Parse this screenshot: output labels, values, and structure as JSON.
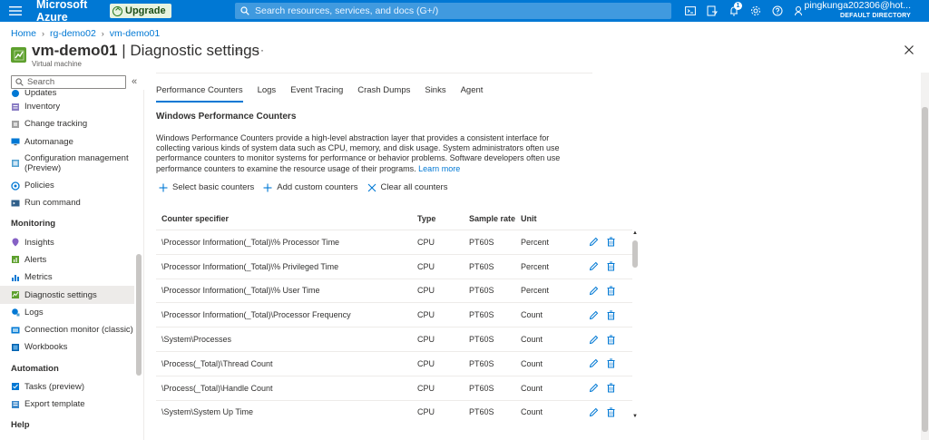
{
  "topbar": {
    "brand": "Microsoft Azure",
    "upgrade_label": "Upgrade",
    "search_placeholder": "Search resources, services, and docs (G+/)",
    "notification_count": "1",
    "user": "pingkunga202306@hot...",
    "directory": "DEFAULT DIRECTORY",
    "icons": [
      "cloud-shell-icon",
      "directory-filter-icon",
      "notifications-icon",
      "settings-icon",
      "help-icon",
      "feedback-icon"
    ]
  },
  "breadcrumb": [
    "Home",
    "rg-demo02",
    "vm-demo01"
  ],
  "header": {
    "resource_name": "vm-demo01",
    "separator": " | ",
    "page_name": "Diagnostic settings",
    "subtitle": "Virtual machine"
  },
  "sidebar": {
    "search_placeholder": "Search",
    "collapse_glyph": "«",
    "items": [
      {
        "label": "Updates",
        "icon": "updates-icon"
      },
      {
        "label": "Inventory",
        "icon": "inventory-icon"
      },
      {
        "label": "Change tracking",
        "icon": "change-tracking-icon"
      },
      {
        "label": "Automanage",
        "icon": "automanage-icon"
      },
      {
        "label": "Configuration management (Preview)",
        "icon": "configuration-icon"
      },
      {
        "label": "Policies",
        "icon": "policies-icon"
      },
      {
        "label": "Run command",
        "icon": "run-command-icon"
      }
    ],
    "group_monitoring": "Monitoring",
    "monitoring_items": [
      {
        "label": "Insights",
        "icon": "insights-icon"
      },
      {
        "label": "Alerts",
        "icon": "alerts-icon"
      },
      {
        "label": "Metrics",
        "icon": "metrics-icon"
      },
      {
        "label": "Diagnostic settings",
        "icon": "diagnostic-settings-icon"
      },
      {
        "label": "Logs",
        "icon": "logs-icon"
      },
      {
        "label": "Connection monitor (classic)",
        "icon": "connection-monitor-icon"
      },
      {
        "label": "Workbooks",
        "icon": "workbooks-icon"
      }
    ],
    "group_automation": "Automation",
    "automation_items": [
      {
        "label": "Tasks (preview)",
        "icon": "tasks-icon"
      },
      {
        "label": "Export template",
        "icon": "export-template-icon"
      }
    ],
    "group_help": "Help"
  },
  "tabs": [
    "Performance Counters",
    "Logs",
    "Event Tracing",
    "Crash Dumps",
    "Sinks",
    "Agent"
  ],
  "active_tab": "Performance Counters",
  "section": {
    "title": "Windows Performance Counters",
    "description": "Windows Performance Counters provide a high-level abstraction layer that provides a consistent interface for collecting various kinds of system data such as CPU, memory, and disk usage. System administrators often use performance counters to monitor systems for performance or behavior problems. Software developers often use performance counters to examine the resource usage of their programs.",
    "learn_more": "Learn more"
  },
  "actions": {
    "select_basic": "Select basic counters",
    "add_custom": "Add custom counters",
    "clear_all": "Clear all counters"
  },
  "table": {
    "headers": [
      "Counter specifier",
      "Type",
      "Sample rate",
      "Unit"
    ],
    "rows": [
      [
        "\\Processor Information(_Total)\\% Processor Time",
        "CPU",
        "PT60S",
        "Percent"
      ],
      [
        "\\Processor Information(_Total)\\% Privileged Time",
        "CPU",
        "PT60S",
        "Percent"
      ],
      [
        "\\Processor Information(_Total)\\% User Time",
        "CPU",
        "PT60S",
        "Percent"
      ],
      [
        "\\Processor Information(_Total)\\Processor Frequency",
        "CPU",
        "PT60S",
        "Count"
      ],
      [
        "\\System\\Processes",
        "CPU",
        "PT60S",
        "Count"
      ],
      [
        "\\Process(_Total)\\Thread Count",
        "CPU",
        "PT60S",
        "Count"
      ],
      [
        "\\Process(_Total)\\Handle Count",
        "CPU",
        "PT60S",
        "Count"
      ],
      [
        "\\System\\System Up Time",
        "CPU",
        "PT60S",
        "Count"
      ]
    ]
  },
  "colors": {
    "accent": "#0078d4",
    "topbar": "#0078d4",
    "resource_icon": "#5ea02e",
    "active_row": "#edebe9"
  }
}
